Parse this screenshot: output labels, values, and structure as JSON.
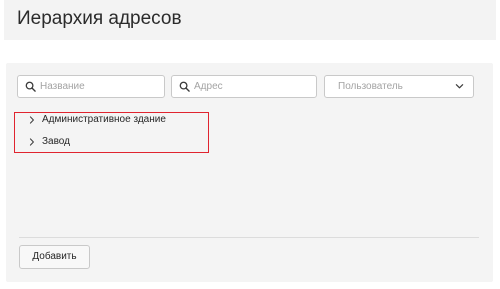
{
  "header": {
    "title": "Иерархия адресов"
  },
  "filters": {
    "name_placeholder": "Название",
    "address_placeholder": "Адрес",
    "user_placeholder": "Пользователь"
  },
  "tree": {
    "items": [
      {
        "label": "Административное здание",
        "expanded": false
      },
      {
        "label": "Завод",
        "expanded": false
      }
    ]
  },
  "actions": {
    "add_label": "Добавить"
  },
  "colors": {
    "highlight": "#e0242f",
    "panel": "#f4f4f4",
    "header_bg": "#f3f3f3"
  },
  "icons": {
    "search": "search-icon",
    "dropdown": "chevron-down-icon",
    "tree_arrow": "chevron-right-icon"
  }
}
